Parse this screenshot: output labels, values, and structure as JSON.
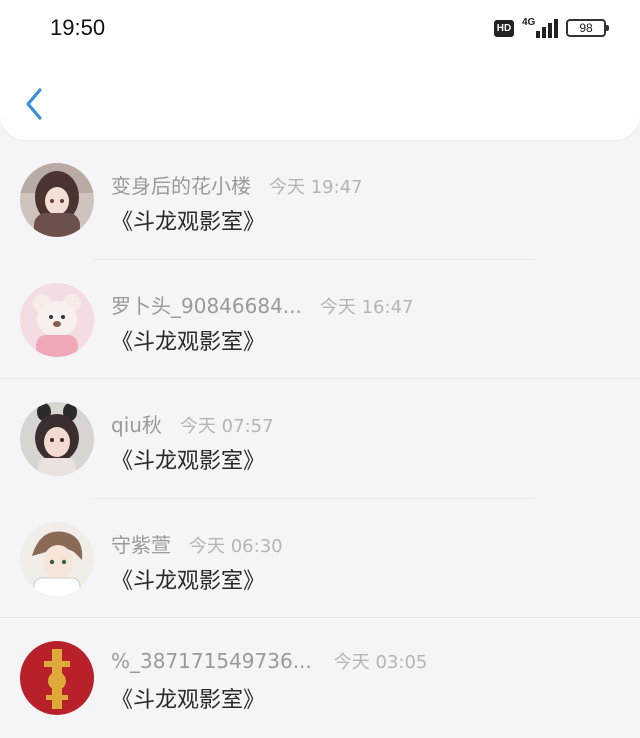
{
  "status_bar": {
    "time": "19:50",
    "hd_label": "HD",
    "network_label": "4G",
    "battery": "98"
  },
  "nav": {
    "back_icon": "chevron-left-icon",
    "accent_color": "#3a8fd8"
  },
  "conversations": [
    {
      "name": "变身后的花小楼",
      "time": "今天 19:47",
      "message": "《斗龙观影室》"
    },
    {
      "name": "罗卜头_90846684...",
      "time": "今天 16:47",
      "message": "《斗龙观影室》"
    },
    {
      "name": "qiu秋",
      "time": "今天 07:57",
      "message": "《斗龙观影室》"
    },
    {
      "name": "守紫萱",
      "time": "今天 06:30",
      "message": "《斗龙观影室》"
    },
    {
      "name": "%_387171549736...",
      "time": "今天 03:05",
      "message": "《斗龙观影室》"
    }
  ]
}
